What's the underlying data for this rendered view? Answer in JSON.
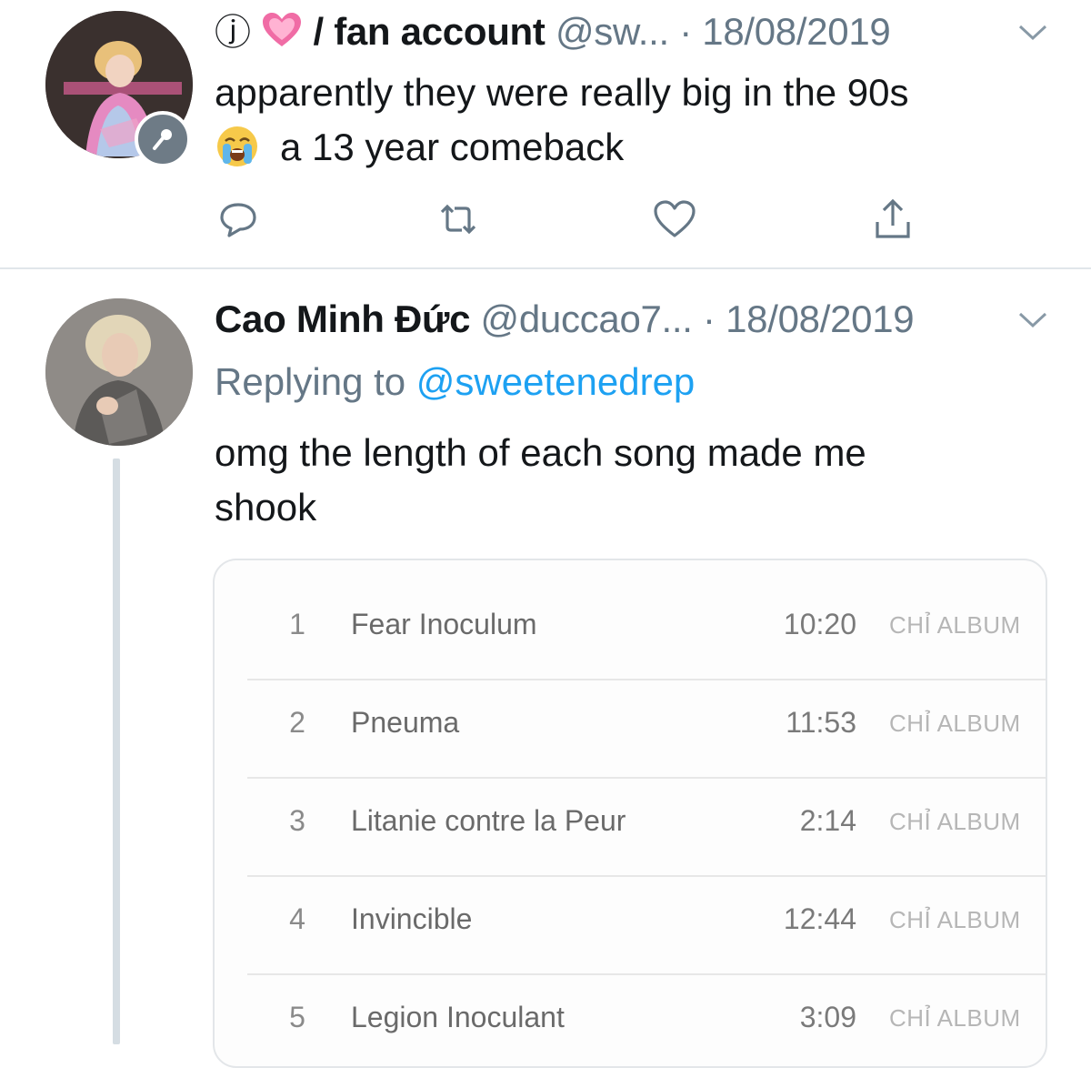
{
  "tweet1": {
    "avatar_alt": "avatar",
    "badge_icon": "microphone-icon",
    "name_prefix_glyph": "ⓙ",
    "name_emoji": "growing-heart",
    "name": "/ fan account",
    "handle": "@sw...",
    "date": "· 18/08/2019",
    "text_line1": "apparently they were really big in the 90s",
    "text_line2": "a 13 year comeback",
    "text_emoji": "loudly-crying-face",
    "actions": [
      "reply-icon",
      "retweet-icon",
      "like-icon",
      "share-icon"
    ]
  },
  "tweet2": {
    "name": "Cao Minh Đức",
    "handle": "@duccao7...",
    "date": "· 18/08/2019",
    "replying_prefix": "Replying to",
    "replying_mention": "@sweetenedrep",
    "text_line1": "omg the length of each song made me",
    "text_line2": "shook",
    "tracks": [
      {
        "num": "1",
        "title": "Fear Inoculum",
        "duration": "10:20",
        "tag": "CHỈ ALBUM"
      },
      {
        "num": "2",
        "title": "Pneuma",
        "duration": "11:53",
        "tag": "CHỈ ALBUM"
      },
      {
        "num": "3",
        "title": "Litanie contre la Peur",
        "duration": "2:14",
        "tag": "CHỈ ALBUM"
      },
      {
        "num": "4",
        "title": "Invincible",
        "duration": "12:44",
        "tag": "CHỈ ALBUM"
      },
      {
        "num": "5",
        "title": "Legion Inoculant",
        "duration": "3:09",
        "tag": "CHỈ ALBUM"
      }
    ]
  },
  "colors": {
    "text": "#14171a",
    "secondary": "#657786",
    "link": "#1da1f2",
    "divider": "#e1e6ea",
    "heart_pink": "#f06ca5"
  }
}
